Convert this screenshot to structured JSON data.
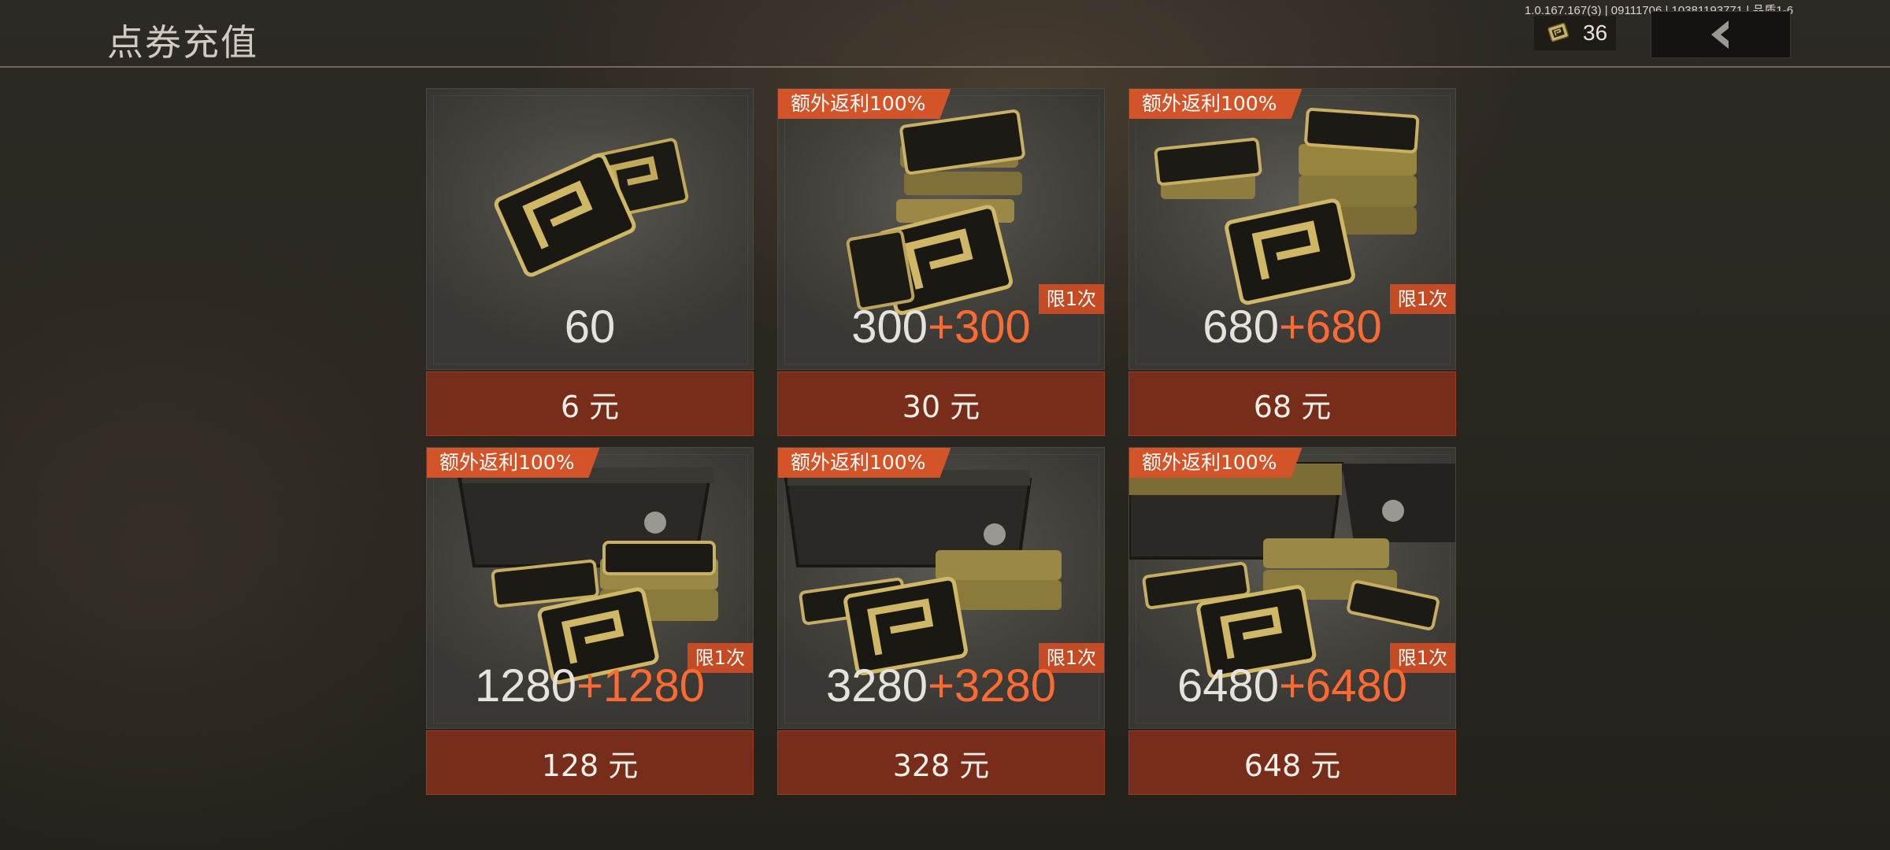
{
  "header": {
    "title": "点券充值",
    "version_info": "1.0.167.167(3) | 09111706 | 10381193771 | 品质1-6",
    "currency": {
      "icon": "coupon-ticket-icon",
      "count": "36"
    },
    "back_icon": "chevron-left-icon"
  },
  "colors": {
    "accent": "#d4542a",
    "bonus_text": "#ff6a33",
    "price_button": "#772d1a",
    "background": "#2a2620"
  },
  "offers": [
    {
      "base": "60",
      "extra": "",
      "bonus_tag": "",
      "limit_tag": "",
      "price": "6 元",
      "art": "small-coupon-pair"
    },
    {
      "base": "300",
      "extra": "+300",
      "bonus_tag": "额外返利100%",
      "limit_tag": "限1次",
      "price": "30 元",
      "art": "coupon-stack"
    },
    {
      "base": "680",
      "extra": "+680",
      "bonus_tag": "额外返利100%",
      "limit_tag": "限1次",
      "price": "68 元",
      "art": "coupon-piles"
    },
    {
      "base": "1280",
      "extra": "+1280",
      "bonus_tag": "额外返利100%",
      "limit_tag": "限1次",
      "price": "128 元",
      "art": "coupon-box"
    },
    {
      "base": "3280",
      "extra": "+3280",
      "bonus_tag": "额外返利100%",
      "limit_tag": "限1次",
      "price": "328 元",
      "art": "coupon-crate"
    },
    {
      "base": "6480",
      "extra": "+6480",
      "bonus_tag": "额外返利100%",
      "limit_tag": "限1次",
      "price": "648 元",
      "art": "coupon-case"
    }
  ]
}
